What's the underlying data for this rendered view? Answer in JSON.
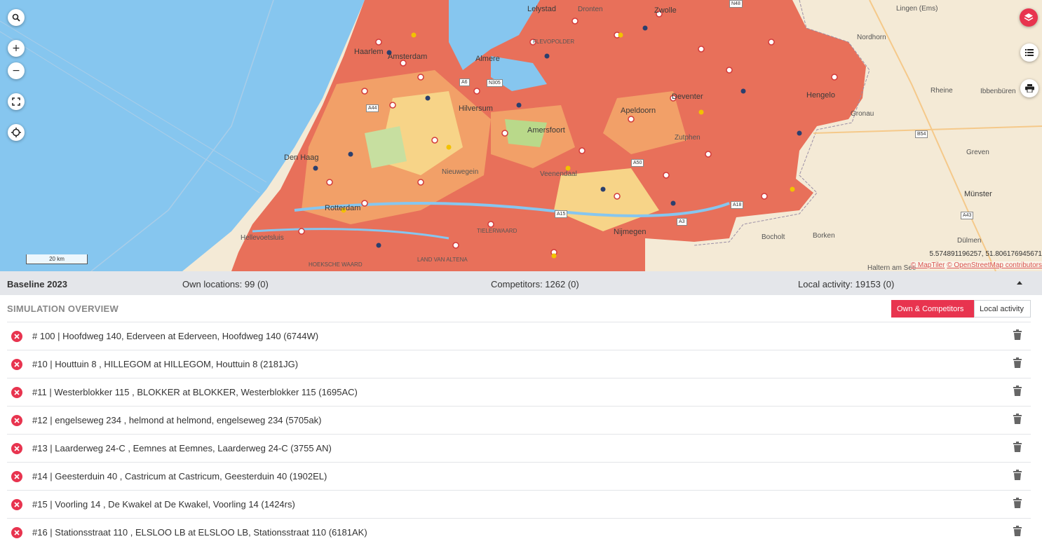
{
  "map": {
    "labels": {
      "lelystad": "Lelystad",
      "zwolle": "Zwolle",
      "dronten": "Dronten",
      "lingen": "Lingen (Ems)",
      "nordhorn": "Nordhorn",
      "haarlem": "Haarlem",
      "amsterdam": "Amsterdam",
      "almere": "Almere",
      "flevopolder": "FLEVOPOLDER",
      "hilversum": "Hilversum",
      "amersfoort": "Amersfoort",
      "apeldoorn": "Apeldoorn",
      "deventer": "Deventer",
      "hengelo": "Hengelo",
      "rheine": "Rheine",
      "ibbenburen": "Ibbenbüren",
      "gronau": "Gronau",
      "greven": "Greven",
      "munster": "Münster",
      "nieuwegein": "Nieuwegein",
      "veenendaal": "Veenendaal",
      "zutphen": "Zutphen",
      "den_haag": "Den Haag",
      "rotterdam": "Rotterdam",
      "hellevoetsluis": "Hellevoetsluis",
      "nijmegen": "Nijmegen",
      "bocholt": "Bocholt",
      "borken": "Borken",
      "dulmen": "Dülmen",
      "haltern": "Haltern am See",
      "tielerwaard": "TIELERWAARD",
      "land_van_altena": "LAND VAN ALTENA",
      "hoeksche_waard": "HOEKSCHE WAARD"
    },
    "roads": [
      "N48",
      "N305",
      "A6",
      "A44",
      "A50",
      "A15",
      "A18",
      "A3",
      "B54",
      "A43"
    ],
    "scale_label": "20 km",
    "coordinates": "5.574891196257, 51.806176945671",
    "attribution": {
      "maptiler": "© MapTiler",
      "osm": "© OpenStreetMap contributors"
    },
    "controls": {
      "search": "search-icon",
      "zoom_in": "+",
      "zoom_out": "−",
      "fullscreen": "fullscreen-icon",
      "locate": "locate-icon"
    },
    "colors": {
      "water": "#86c6ef",
      "land": "#f4ead6",
      "heat_high": "#e8705a",
      "heat_mid": "#f2a068",
      "heat_low": "#f7d488",
      "accent": "#e8344f"
    }
  },
  "statusbar": {
    "scenario": "Baseline 2023",
    "own_locations": "Own locations: 99 (0)",
    "competitors": "Competitors: 1262 (0)",
    "local_activity": "Local activity: 19153 (0)"
  },
  "overview": {
    "title": "SIMULATION OVERVIEW",
    "toggle_own": "Own & Competitors",
    "toggle_local": "Local activity",
    "rows": [
      "# 100 | Hoofdweg 140, Ederveen at Ederveen, Hoofdweg 140 (6744W)",
      "#10 | Houttuin 8 , HILLEGOM at HILLEGOM, Houttuin 8 (2181JG)",
      "#11 | Westerblokker 115 , BLOKKER at BLOKKER, Westerblokker 115 (1695AC)",
      "#12 | engelseweg 234 , helmond at helmond, engelseweg 234 (5705ak)",
      "#13 | Laarderweg 24-C , Eemnes at Eemnes, Laarderweg 24-C (3755 AN)",
      "#14 | Geesterduin 40 , Castricum at Castricum, Geesterduin 40 (1902EL)",
      "#15 | Voorling 14 , De Kwakel at De Kwakel, Voorling 14 (1424rs)",
      "#16 | Stationsstraat 110 , ELSLOO LB at ELSLOO LB, Stationsstraat 110 (6181AK)"
    ]
  }
}
